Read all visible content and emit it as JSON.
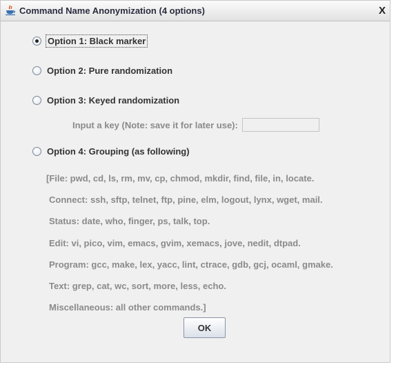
{
  "window": {
    "title": "Command Name Anonymization (4 options)",
    "close_label": "X",
    "icon": "java-cup-icon"
  },
  "options": [
    {
      "label": "Option 1: Black marker",
      "selected": true
    },
    {
      "label": "Option 2: Pure randomization",
      "selected": false
    },
    {
      "label": "Option 3: Keyed randomization",
      "selected": false
    },
    {
      "label": "Option 4: Grouping (as following)",
      "selected": false
    }
  ],
  "key_field": {
    "label": "Input a key (Note: save it for later use):",
    "value": ""
  },
  "groups": [
    "[File: pwd, cd, ls, rm, mv, cp, chmod, mkdir, find, file, in, locate.",
    "Connect: ssh, sftp, telnet, ftp, pine, elm, logout, lynx, wget, mail.",
    "Status: date, who, finger, ps, talk, top.",
    "Edit: vi, pico, vim, emacs, gvim, xemacs, jove, nedit, dtpad.",
    "Program: gcc, make, lex, yacc, lint, ctrace, gdb, gcj, ocaml, gmake.",
    "Text: grep, cat, wc, sort, more, less, echo.",
    "Miscellaneous: all other commands.]"
  ],
  "ok_label": "OK"
}
